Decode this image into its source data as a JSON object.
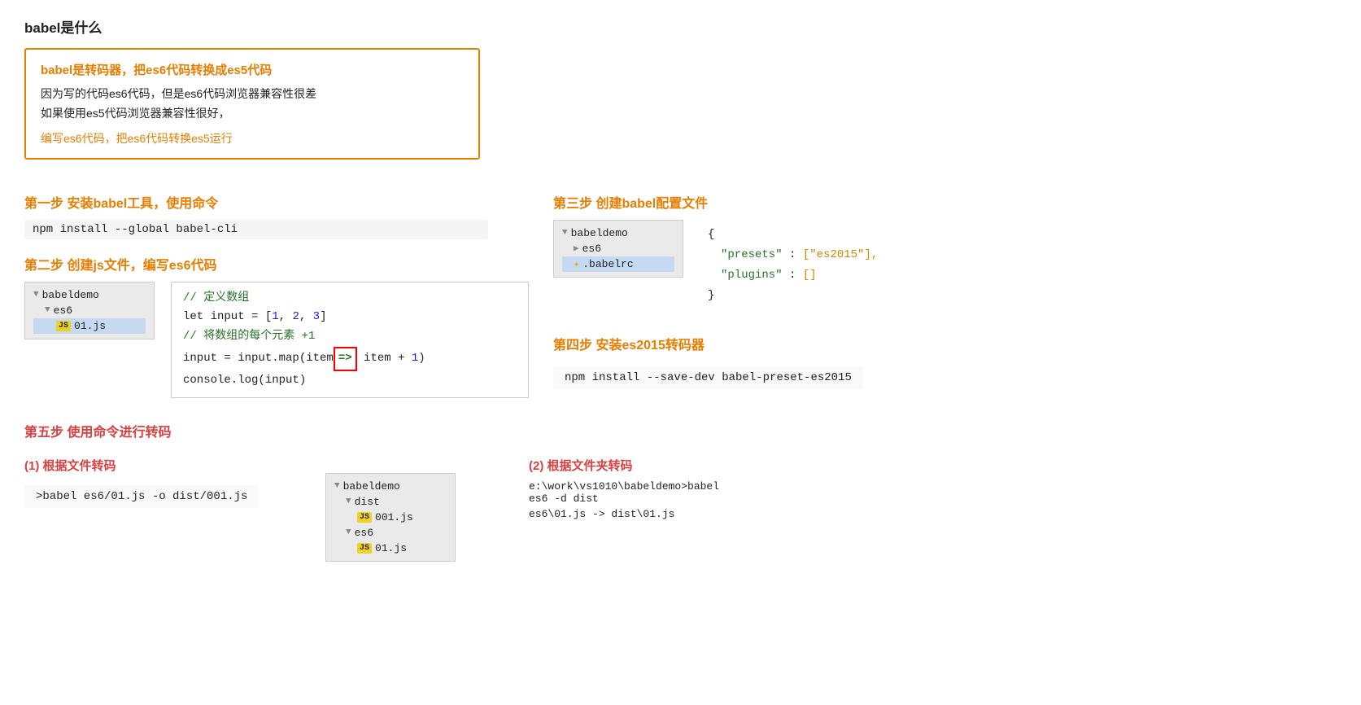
{
  "page": {
    "title": "babel是什么",
    "orange_box": {
      "heading": "babel是转码器，把es6代码转换成es5代码",
      "body": "因为写的代码es6代码，但是es6代码浏览器兼容性很差\n如果使用es5代码浏览器兼容性很好，",
      "footer": "编写es6代码，把es6代码转换es5运行"
    },
    "step1": {
      "title": "第一步  安装babel工具，使用命令",
      "command": "npm install --global babel-cli"
    },
    "step2": {
      "title": "第二步  创建js文件，编写es6代码",
      "file_tree": {
        "root": "babeldemo",
        "children": [
          {
            "name": "es6",
            "type": "folder",
            "children": [
              {
                "name": "01.js",
                "type": "js",
                "selected": true
              }
            ]
          }
        ]
      },
      "code_comment": "// 定义数组",
      "code_line1": "let input = [",
      "code_num1": "1",
      "code_comma1": ", ",
      "code_num2": "2",
      "code_comma2": ", ",
      "code_num3": "3",
      "code_bracket": "]",
      "code_comment2": "// 将数组的每个元素 +1",
      "code_map_pre": "input = input.map(item",
      "code_arrow": "=>",
      "code_map_post": "item + ",
      "code_map_num": "1",
      "code_map_close": ")",
      "code_console": "console.log(input)"
    },
    "step3": {
      "title": "第三步  创建babel配置文件",
      "file_tree": {
        "root": "babeldemo",
        "children": [
          {
            "name": "es6",
            "type": "folder"
          },
          {
            "name": ".babelrc",
            "type": "babelrc",
            "selected": true
          }
        ]
      },
      "json_open": "{",
      "json_presets_key": "\"presets\"",
      "json_presets_val": "[\"es2015\"],",
      "json_plugins_key": "\"plugins\"",
      "json_plugins_val": "[]",
      "json_close": "}"
    },
    "step4": {
      "title": "第四步  安装es2015转码器",
      "command": "npm install --save-dev babel-preset-es2015"
    },
    "step5": {
      "title": "第五步  使用命令进行转码",
      "sub1": {
        "title": "(1) 根据文件转码",
        "command": ">babel es6/01.js -o dist/001.js"
      },
      "sub2": {
        "title": "(2) 根据文件夹转码",
        "command1": "e:\\work\\vs1010\\babeldemo>babel es6 -d dist",
        "command2": "es6\\01.js -> dist\\01.js"
      },
      "file_tree": {
        "root": "babeldemo",
        "children": [
          {
            "name": "dist",
            "type": "folder",
            "children": [
              {
                "name": "001.js",
                "type": "js",
                "selected": false
              }
            ]
          },
          {
            "name": "es6",
            "type": "folder",
            "children": [
              {
                "name": "01.js",
                "type": "js",
                "selected": false
              }
            ]
          }
        ]
      }
    }
  }
}
